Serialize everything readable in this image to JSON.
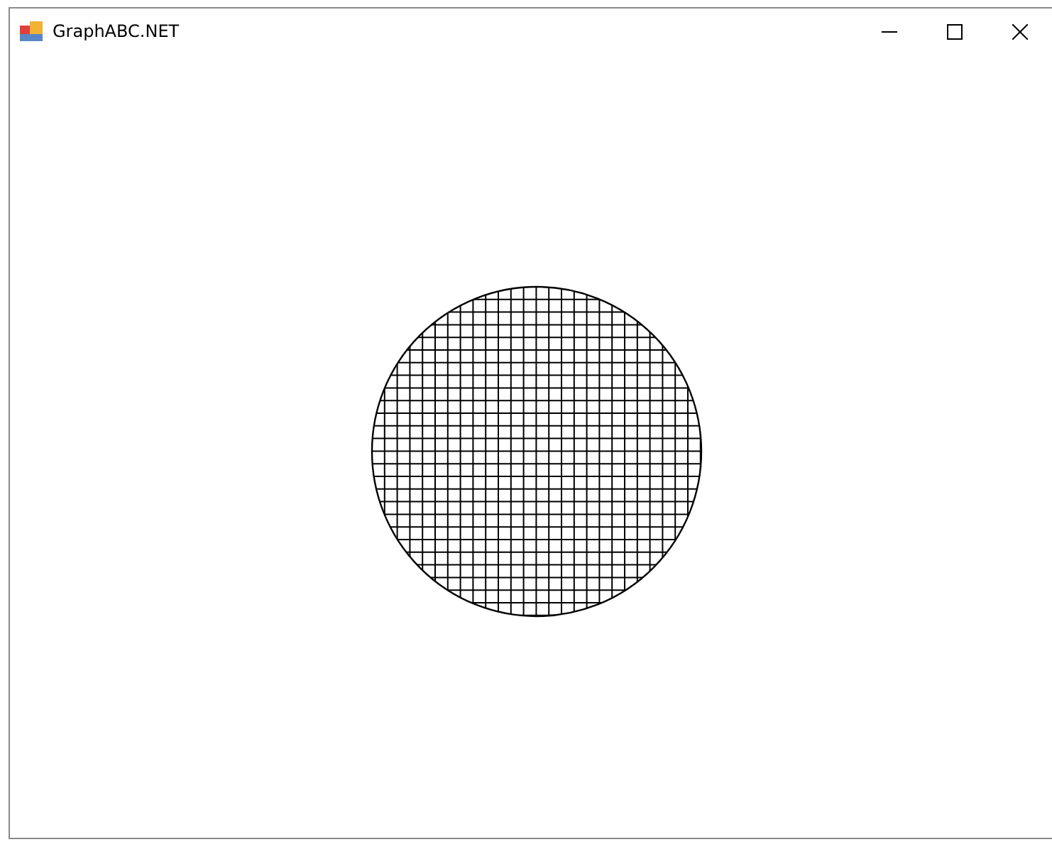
{
  "window": {
    "title": "GraphABC.NET"
  }
}
